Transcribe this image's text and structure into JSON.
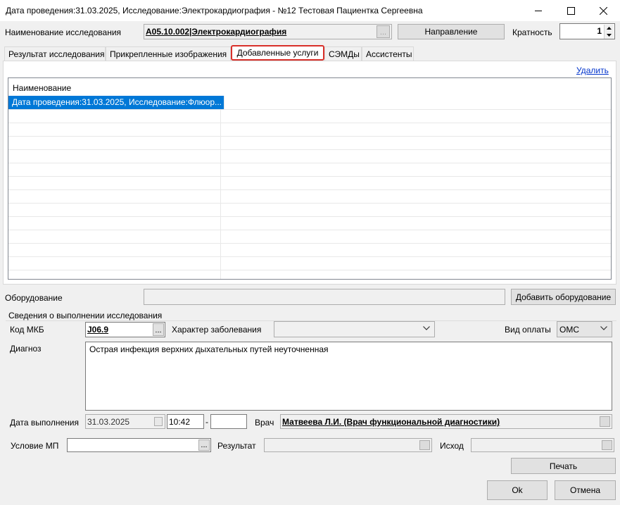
{
  "window": {
    "title": "Дата проведения:31.03.2025, Исследование:Электрокардиография - №12 Тестовая Пациентка Сергеевна"
  },
  "header": {
    "study_name_label": "Наименование исследования",
    "study_name_value": "A05.10.002|Электрокардиография",
    "direction_button": "Направление",
    "multiplicity_label": "Кратность",
    "multiplicity_value": "1"
  },
  "tabs": [
    {
      "label": "Результат исследования"
    },
    {
      "label": "Прикрепленные изображения"
    },
    {
      "label": "Добавленные услуги"
    },
    {
      "label": "СЭМДы"
    },
    {
      "label": "Ассистенты"
    }
  ],
  "active_tab": "Добавленные услуги",
  "services": {
    "delete_link": "Удалить",
    "column_header": "Наименование",
    "rows": [
      "Дата проведения:31.03.2025, Исследование:Флюор..."
    ]
  },
  "equipment": {
    "label": "Оборудование",
    "value": "",
    "add_button": "Добавить оборудование"
  },
  "execution": {
    "group_title": "Сведения о выполнении исследования",
    "mkb_label": "Код МКБ",
    "mkb_value": "J06.9",
    "disease_character_label": "Характер заболевания",
    "disease_character_value": "",
    "payment_label": "Вид оплаты",
    "payment_value": "ОМС",
    "diagnosis_label": "Диагноз",
    "diagnosis_value": "Острая инфекция верхних дыхательных путей неуточненная",
    "date_label": "Дата выполнения",
    "date_value": "31.03.2025",
    "time_from": "10:42",
    "time_separator": "-",
    "time_to": "",
    "doctor_label": "Врач",
    "doctor_value": "Матвеева Л.И. (Врач функциональной диагностики)"
  },
  "bottom": {
    "condition_label": "Условие МП",
    "condition_value": "",
    "result_label": "Результат",
    "result_value": "",
    "outcome_label": "Исход",
    "outcome_value": "",
    "print_button": "Печать",
    "ok_button": "Ok",
    "cancel_button": "Отмена"
  }
}
